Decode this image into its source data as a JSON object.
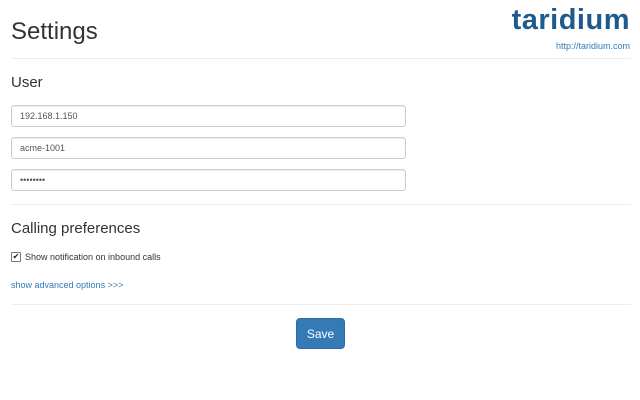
{
  "header": {
    "title": "Settings",
    "logo_text": "taridium",
    "logo_link": "http://taridium.com"
  },
  "user_section": {
    "heading": "User",
    "fields": [
      {
        "value": "192.168.1.150"
      },
      {
        "value": "acme-1001"
      },
      {
        "value": "password",
        "masked": true
      }
    ]
  },
  "calling_section": {
    "heading": "Calling preferences",
    "notification_checkbox": {
      "label": "Show notification on inbound calls",
      "checked": true
    },
    "advanced_link": "show advanced options >>>"
  },
  "actions": {
    "save_label": "Save"
  },
  "colors": {
    "accent": "#337ab7",
    "logo": "#1e5a8e"
  },
  "icons": {
    "checkbox_check": "check-icon"
  }
}
